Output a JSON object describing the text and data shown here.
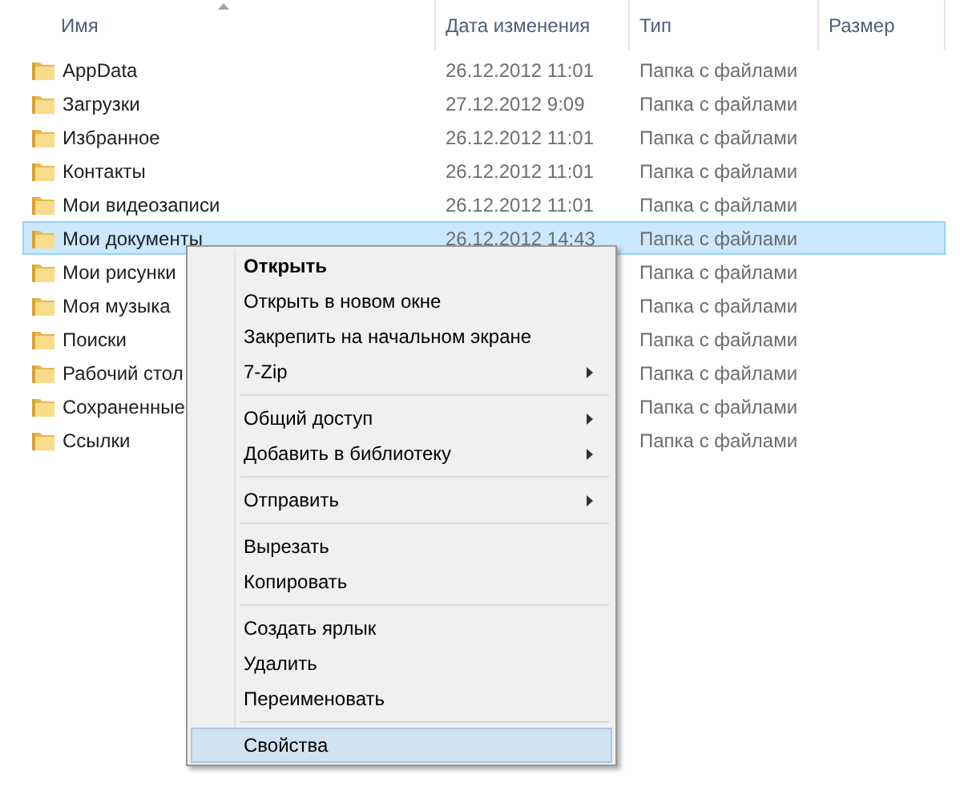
{
  "columns": [
    {
      "label": "Имя",
      "sorted": true
    },
    {
      "label": "Дата изменения",
      "sorted": false
    },
    {
      "label": "Тип",
      "sorted": false
    },
    {
      "label": "Размер",
      "sorted": false
    }
  ],
  "rows": [
    {
      "name": "AppData",
      "date": "26.12.2012 11:01",
      "type": "Папка с файлами",
      "selected": false
    },
    {
      "name": "Загрузки",
      "date": "27.12.2012 9:09",
      "type": "Папка с файлами",
      "selected": false
    },
    {
      "name": "Избранное",
      "date": "26.12.2012 11:01",
      "type": "Папка с файлами",
      "selected": false
    },
    {
      "name": "Контакты",
      "date": "26.12.2012 11:01",
      "type": "Папка с файлами",
      "selected": false
    },
    {
      "name": "Мои видеозаписи",
      "date": "26.12.2012 11:01",
      "type": "Папка с файлами",
      "selected": false
    },
    {
      "name": "Мои документы",
      "date": "26.12.2012 14:43",
      "type": "Папка с файлами",
      "selected": true
    },
    {
      "name": "Мои рисунки",
      "type": "Папка с файлами",
      "selected": false
    },
    {
      "name": "Моя музыка",
      "type": "Папка с файлами",
      "selected": false
    },
    {
      "name": "Поиски",
      "type": "Папка с файлами",
      "selected": false
    },
    {
      "name": "Рабочий стол",
      "type": "Папка с файлами",
      "selected": false
    },
    {
      "name": "Сохраненные",
      "type": "Папка с файлами",
      "selected": false
    },
    {
      "name": "Ссылки",
      "type": "Папка с файлами",
      "selected": false
    }
  ],
  "context_menu": {
    "groups": [
      [
        {
          "label": "Открыть",
          "default": true,
          "submenu": false,
          "selected": false
        },
        {
          "label": "Открыть в новом окне",
          "default": false,
          "submenu": false,
          "selected": false
        },
        {
          "label": "Закрепить на начальном экране",
          "default": false,
          "submenu": false,
          "selected": false
        },
        {
          "label": "7-Zip",
          "default": false,
          "submenu": true,
          "selected": false
        }
      ],
      [
        {
          "label": "Общий доступ",
          "default": false,
          "submenu": true,
          "selected": false
        },
        {
          "label": "Добавить в библиотеку",
          "default": false,
          "submenu": true,
          "selected": false
        }
      ],
      [
        {
          "label": "Отправить",
          "default": false,
          "submenu": true,
          "selected": false
        }
      ],
      [
        {
          "label": "Вырезать",
          "default": false,
          "submenu": false,
          "selected": false
        },
        {
          "label": "Копировать",
          "default": false,
          "submenu": false,
          "selected": false
        }
      ],
      [
        {
          "label": "Создать ярлык",
          "default": false,
          "submenu": false,
          "selected": false
        },
        {
          "label": "Удалить",
          "default": false,
          "submenu": false,
          "selected": false
        },
        {
          "label": "Переименовать",
          "default": false,
          "submenu": false,
          "selected": false
        }
      ],
      [
        {
          "label": "Свойства",
          "default": false,
          "submenu": false,
          "selected": true
        }
      ]
    ]
  }
}
